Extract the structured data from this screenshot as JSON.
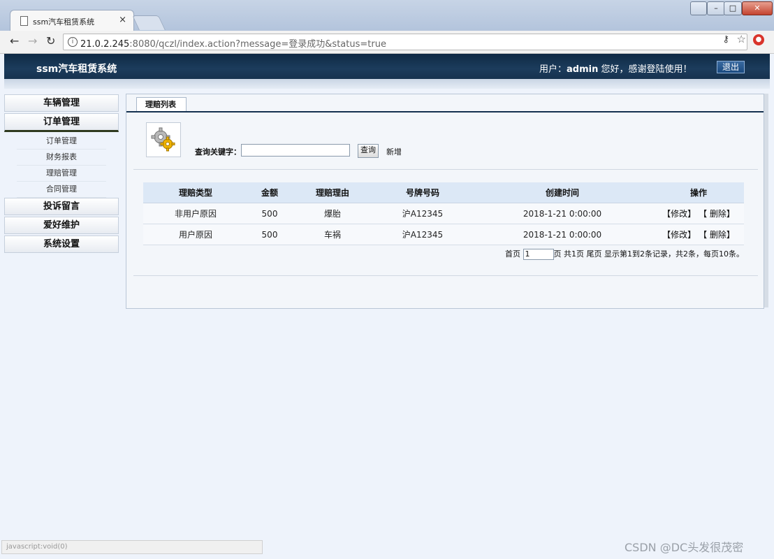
{
  "browser": {
    "tab_title": "ssm汽车租赁系统",
    "tab_close": "×",
    "url_host": "21.0.2.245",
    "url_rest": ":8080/qczl/index.action?message=登录成功&status=true",
    "window_controls": {
      "minimize": "–",
      "maximize": "□",
      "close": "✕"
    }
  },
  "header": {
    "title": "ssm汽车租赁系统",
    "greeting_prefix": "用户：",
    "username": "admin",
    "greeting_suffix": " 您好，感谢登陆使用！",
    "logout_label": "退出"
  },
  "sidebar": {
    "menus": [
      {
        "label": "车辆管理"
      },
      {
        "label": "订单管理",
        "active": true,
        "items": [
          "订单管理",
          "财务报表",
          "理赔管理",
          "合同管理"
        ]
      },
      {
        "label": "投诉留言"
      },
      {
        "label": "爱好维护"
      },
      {
        "label": "系统设置"
      }
    ]
  },
  "main": {
    "tab_label": "理赔列表",
    "search_label": "查询关键字：",
    "search_value": "",
    "search_button": "查询",
    "add_link": "新增",
    "table": {
      "columns": [
        "理赔类型",
        "金额",
        "理赔理由",
        "号牌号码",
        "创建时间",
        "操作"
      ],
      "rows": [
        {
          "type": "非用户原因",
          "amount": "500",
          "reason": "爆胎",
          "plate": "沪A12345",
          "created": "2018-1-21 0:00:00",
          "edit": "【修改】",
          "delete": "【 删除】"
        },
        {
          "type": "用户原因",
          "amount": "500",
          "reason": "车祸",
          "plate": "沪A12345",
          "created": "2018-1-21 0:00:00",
          "edit": "【修改】",
          "delete": "【 删除】"
        }
      ]
    },
    "pager": {
      "first": "首页",
      "page_value": "1",
      "page_suffix": "页",
      "total_pages": "共1页",
      "last": "尾页",
      "summary": "显示第1到2条记录，共2条，每页10条。"
    }
  },
  "status_bar": "javascript:void(0)",
  "watermark": "CSDN @DC头发很茂密"
}
